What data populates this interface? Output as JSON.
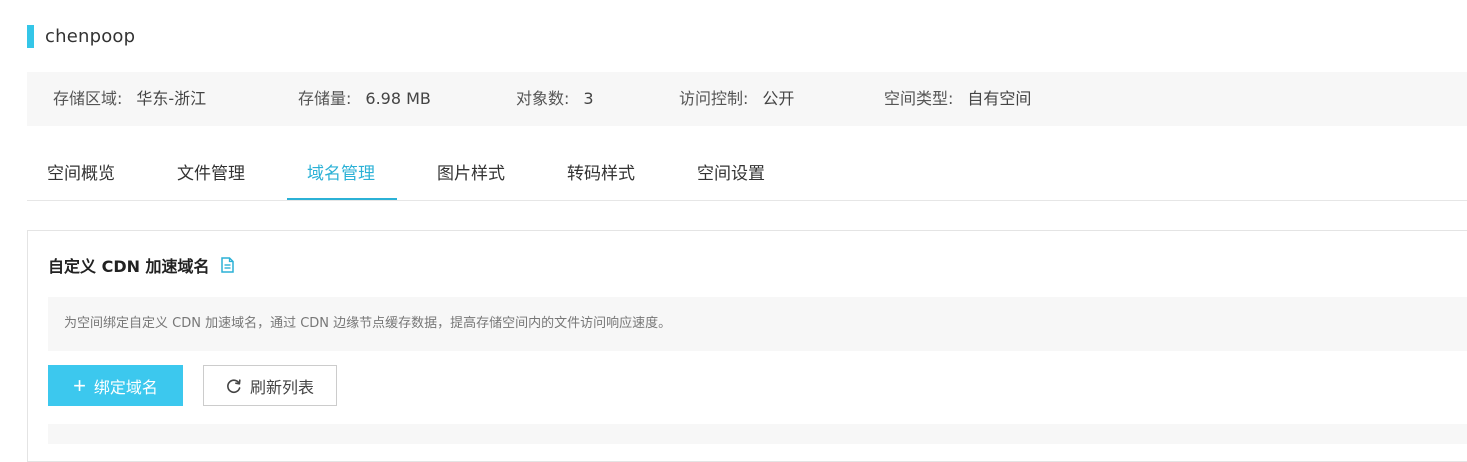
{
  "bucket": {
    "name": "chenpoop"
  },
  "info": [
    {
      "label": "存储区域:",
      "value": "华东-浙江"
    },
    {
      "label": "存储量:",
      "value": "6.98 MB"
    },
    {
      "label": "对象数:",
      "value": "3"
    },
    {
      "label": "访问控制:",
      "value": "公开"
    },
    {
      "label": "空间类型:",
      "value": "自有空间"
    }
  ],
  "tabs": [
    {
      "label": "空间概览"
    },
    {
      "label": "文件管理"
    },
    {
      "label": "域名管理",
      "active": true
    },
    {
      "label": "图片样式"
    },
    {
      "label": "转码样式"
    },
    {
      "label": "空间设置"
    }
  ],
  "section": {
    "title": "自定义 CDN 加速域名",
    "doc_icon": "document-icon",
    "notice": "为空间绑定自定义 CDN 加速域名，通过 CDN 边缘节点缓存数据，提高存储空间内的文件访问响应速度。"
  },
  "buttons": {
    "bind_label": "绑定域名",
    "bind_icon": "plus-icon",
    "refresh_label": "刷新列表",
    "refresh_icon": "refresh-icon"
  },
  "colors": {
    "accent": "#2bb1d6",
    "primary_button": "#3cc8ee",
    "title_bar": "#34c6e8"
  }
}
